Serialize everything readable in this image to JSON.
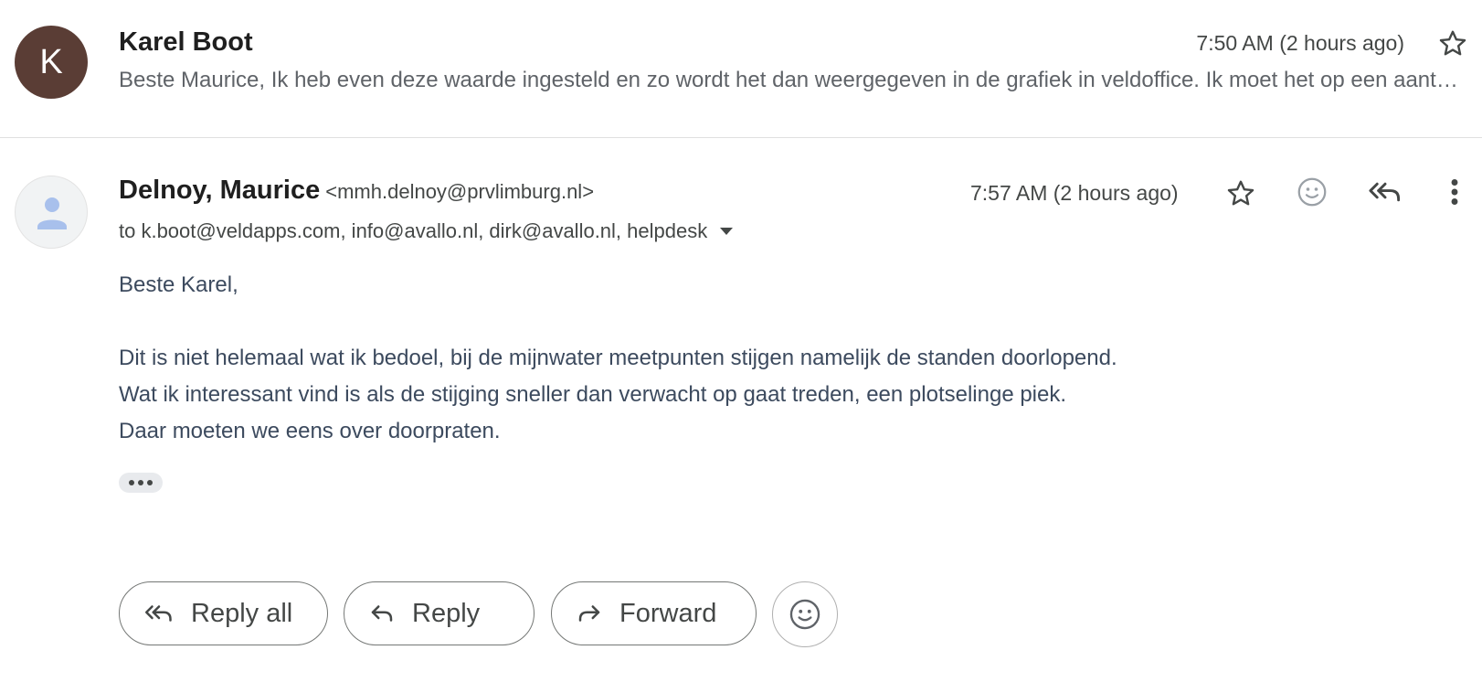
{
  "collapsed_message": {
    "avatar_letter": "K",
    "avatar_color": "#5a3d35",
    "sender": "Karel Boot",
    "time": "7:50 AM (2 hours ago)",
    "snippet": "Beste Maurice, Ik heb even deze waarde ingesteld en zo wordt het dan weergegeven in de grafiek in veldoffice. Ik moet het op een aantal meetpunten nog instellen en zal dit ook aan Dirk doorgeven."
  },
  "expanded_message": {
    "sender": "Delnoy, Maurice",
    "sender_email": "<mmh.delnoy@prvlimburg.nl>",
    "time": "7:57 AM (2 hours ago)",
    "recipients": "to k.boot@veldapps.com, info@avallo.nl, dirk@avallo.nl, helpdesk",
    "body": {
      "greeting": "Beste Karel,",
      "lines": [
        "Dit is niet helemaal wat ik bedoel, bij de mijnwater meetpunten stijgen namelijk de standen doorlopend.",
        "Wat ik interessant vind is als de stijging sneller dan verwacht op gaat treden, een plotselinge piek.",
        "Daar moeten we eens over doorpraten."
      ]
    }
  },
  "actions": {
    "reply_all_label": "Reply all",
    "reply_label": "Reply",
    "forward_label": "Forward"
  },
  "icons": {
    "star": "star-icon",
    "emoji": "emoji-icon",
    "reply_all": "reply-all-icon",
    "reply": "reply-icon",
    "forward": "forward-icon",
    "more": "more-vert-icon"
  },
  "colors": {
    "body_text": "#3c4a5e",
    "secondary_text": "#444746",
    "border": "#747775"
  }
}
